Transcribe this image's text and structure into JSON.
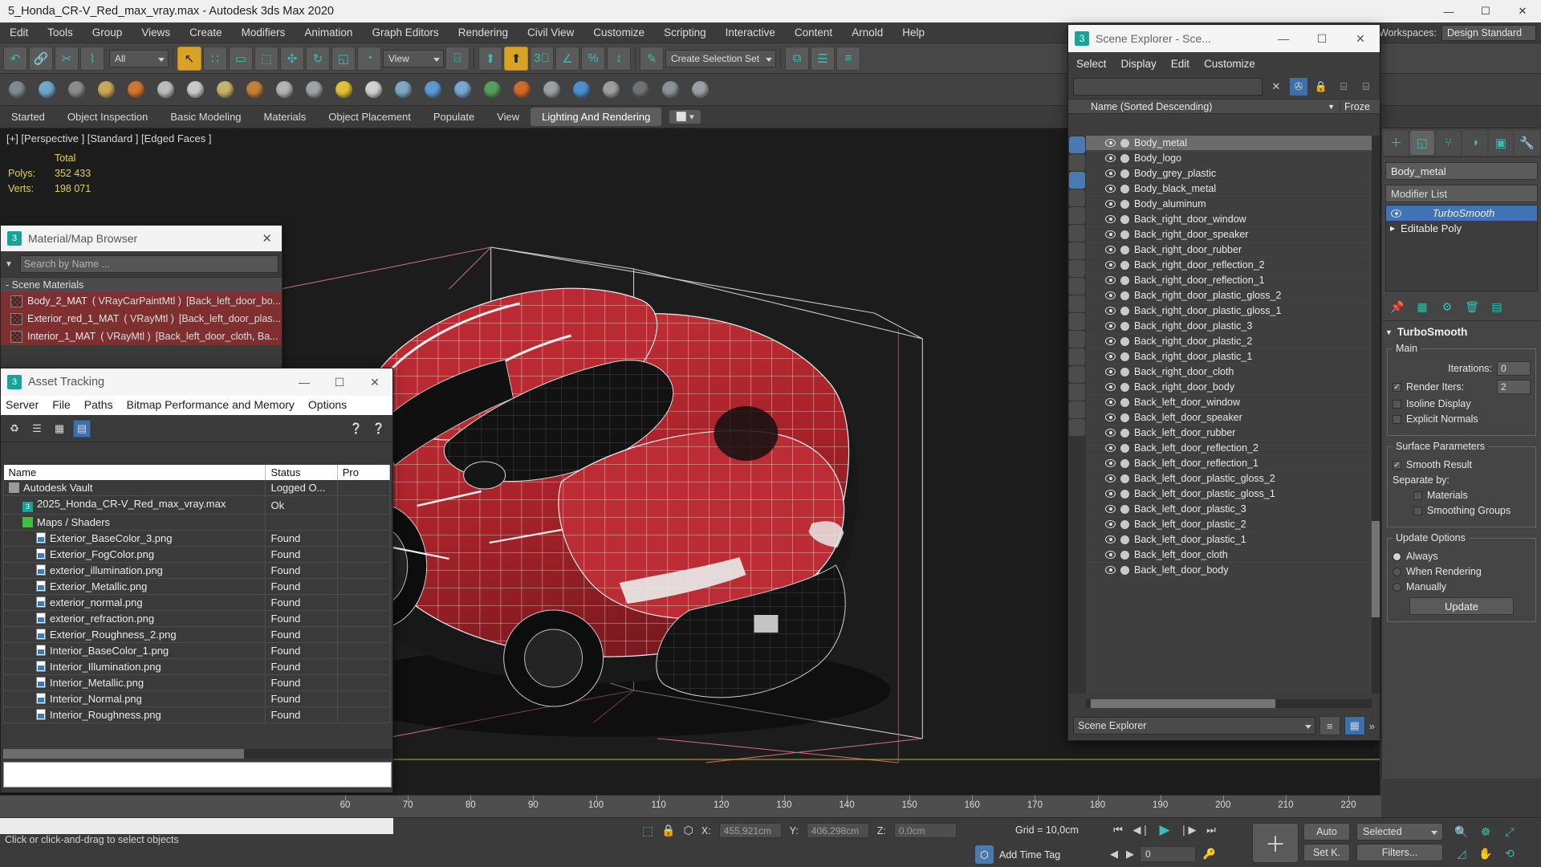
{
  "window": {
    "title": "5_Honda_CR-V_Red_max_vray.max - Autodesk 3ds Max 2020",
    "minimize": "—",
    "maximize": "☐",
    "close": "✕"
  },
  "menubar": {
    "items": [
      "Edit",
      "Tools",
      "Group",
      "Views",
      "Create",
      "Modifiers",
      "Animation",
      "Graph Editors",
      "Rendering",
      "Civil View",
      "Customize",
      "Scripting",
      "Interactive",
      "Content",
      "Arnold",
      "Help"
    ]
  },
  "workspaces": {
    "label": "Workspaces:",
    "value": "Design Standard"
  },
  "maintoolbar": {
    "undo": "↶",
    "redo": "↷",
    "link": "🔗",
    "unlink": "✂",
    "bind": "⌇",
    "selection_filter": "All",
    "select_object": "↖",
    "select_name": "∷",
    "rect_select": "▭",
    "fence": "⬚",
    "move": "✣",
    "rotate": "↻",
    "scale": "◱",
    "placement": "◔",
    "ref_coord": "View",
    "pivot": "⌸",
    "use_center": "⬆",
    "snap3d": "3⃞",
    "angle_snap": "∠",
    "percent_snap": "%",
    "spinner_snap": "↕",
    "named_sets_icon": "✎",
    "named_selection_set": "Create Selection Set",
    "mirror": "⧉",
    "align": "☰",
    "layers": "≡"
  },
  "ribbon_toolbar": {
    "icons": [
      "geosphere-icon",
      "box-icon",
      "array-icon",
      "teapot-icon",
      "bone-icon",
      "sphere-icon",
      "material-editor-icon",
      "render-setup-icon",
      "torus-icon",
      "cone-icon",
      "cylinder-icon",
      "light-icon",
      "sphere2-icon",
      "particles-icon",
      "atom-icon",
      "globe-icon",
      "tree-icon",
      "fire-icon",
      "camera-icon",
      "world-icon",
      "render-frame-icon",
      "render-production-icon",
      "render-iterative-icon",
      "help-icon"
    ]
  },
  "ribbon_tabs": {
    "items": [
      "Started",
      "Object Inspection",
      "Basic Modeling",
      "Materials",
      "Object Placement",
      "Populate",
      "View",
      "Lighting And Rendering"
    ],
    "active": "Lighting And Rendering",
    "extra": "⬜"
  },
  "viewport": {
    "label": "[+] [Perspective ] [Standard ] [Edged Faces ]",
    "stats_title": "Total",
    "polys_label": "Polys:",
    "polys_value": "352 433",
    "verts_label": "Verts:",
    "verts_value": "198 071"
  },
  "material_browser": {
    "title": "Material/Map Browser",
    "close": "✕",
    "search_placeholder": "Search by Name ...",
    "group": "- Scene Materials",
    "items": [
      {
        "name": "Body_2_MAT",
        "type": "( VRayCarPaintMtl )",
        "assign": "[Back_left_door_bo...",
        "selected": true
      },
      {
        "name": "Exterior_red_1_MAT",
        "type": "( VRayMtl )",
        "assign": "[Back_left_door_plas...",
        "selected": true
      },
      {
        "name": "Interior_1_MAT",
        "type": "( VRayMtl )",
        "assign": "[Back_left_door_cloth, Ba...",
        "selected": true
      }
    ]
  },
  "asset_tracking": {
    "title": "Asset Tracking",
    "minimize": "—",
    "maximize": "☐",
    "close": "✕",
    "menu": [
      "Server",
      "File",
      "Paths",
      "Bitmap Performance and Memory",
      "Options"
    ],
    "columns": [
      "Name",
      "Status",
      "Pro"
    ],
    "rows": [
      {
        "indent": 1,
        "icon": "vault-icon",
        "name": "Autodesk Vault",
        "status": "Logged O..."
      },
      {
        "indent": 2,
        "icon": "max-file-icon",
        "name": "2025_Honda_CR-V_Red_max_vray.max",
        "status": "Ok"
      },
      {
        "indent": 2,
        "icon": "maps-icon",
        "name": "Maps / Shaders",
        "status": ""
      },
      {
        "indent": 3,
        "icon": "png-icon",
        "name": "Exterior_BaseColor_3.png",
        "status": "Found"
      },
      {
        "indent": 3,
        "icon": "png-icon",
        "name": "Exterior_FogColor.png",
        "status": "Found"
      },
      {
        "indent": 3,
        "icon": "png-icon",
        "name": "exterior_illumination.png",
        "status": "Found"
      },
      {
        "indent": 3,
        "icon": "png-icon",
        "name": "Exterior_Metallic.png",
        "status": "Found"
      },
      {
        "indent": 3,
        "icon": "png-icon",
        "name": "exterior_normal.png",
        "status": "Found"
      },
      {
        "indent": 3,
        "icon": "png-icon",
        "name": "exterior_refraction.png",
        "status": "Found"
      },
      {
        "indent": 3,
        "icon": "png-icon",
        "name": "Exterior_Roughness_2.png",
        "status": "Found"
      },
      {
        "indent": 3,
        "icon": "png-icon",
        "name": "Interior_BaseColor_1.png",
        "status": "Found"
      },
      {
        "indent": 3,
        "icon": "png-icon",
        "name": "Interior_Illumination.png",
        "status": "Found"
      },
      {
        "indent": 3,
        "icon": "png-icon",
        "name": "Interior_Metallic.png",
        "status": "Found"
      },
      {
        "indent": 3,
        "icon": "png-icon",
        "name": "Interior_Normal.png",
        "status": "Found"
      },
      {
        "indent": 3,
        "icon": "png-icon",
        "name": "Interior_Roughness.png",
        "status": "Found"
      }
    ]
  },
  "scene_explorer": {
    "title": "Scene Explorer - Sce...",
    "app_icon": "3",
    "minimize": "—",
    "maximize": "☐",
    "close": "✕",
    "menu": [
      "Select",
      "Display",
      "Edit",
      "Customize"
    ],
    "filter_value": "",
    "clear_icon": "✕",
    "funnel_icon": "✇",
    "lock_icon": "🔒",
    "expand_icon": "⌸",
    "collapse_icon": "⌸",
    "column_name": "Name (Sorted Descending)",
    "column_sort_arrow": "▼",
    "column_frozen": "Froze",
    "footer_combo": "Scene Explorer",
    "footer_layers_icon": "≡",
    "footer_grid_icon": "▦",
    "footer_more": "»",
    "items": [
      {
        "name": "Body_metal",
        "selected": true
      },
      {
        "name": "Body_logo",
        "selected": false
      },
      {
        "name": "Body_grey_plastic",
        "selected": false
      },
      {
        "name": "Body_black_metal",
        "selected": false
      },
      {
        "name": "Body_aluminum",
        "selected": false
      },
      {
        "name": "Back_right_door_window",
        "selected": false
      },
      {
        "name": "Back_right_door_speaker",
        "selected": false
      },
      {
        "name": "Back_right_door_rubber",
        "selected": false
      },
      {
        "name": "Back_right_door_reflection_2",
        "selected": false
      },
      {
        "name": "Back_right_door_reflection_1",
        "selected": false
      },
      {
        "name": "Back_right_door_plastic_gloss_2",
        "selected": false
      },
      {
        "name": "Back_right_door_plastic_gloss_1",
        "selected": false
      },
      {
        "name": "Back_right_door_plastic_3",
        "selected": false
      },
      {
        "name": "Back_right_door_plastic_2",
        "selected": false
      },
      {
        "name": "Back_right_door_plastic_1",
        "selected": false
      },
      {
        "name": "Back_right_door_cloth",
        "selected": false
      },
      {
        "name": "Back_right_door_body",
        "selected": false
      },
      {
        "name": "Back_left_door_window",
        "selected": false
      },
      {
        "name": "Back_left_door_speaker",
        "selected": false
      },
      {
        "name": "Back_left_door_rubber",
        "selected": false
      },
      {
        "name": "Back_left_door_reflection_2",
        "selected": false
      },
      {
        "name": "Back_left_door_reflection_1",
        "selected": false
      },
      {
        "name": "Back_left_door_plastic_gloss_2",
        "selected": false
      },
      {
        "name": "Back_left_door_plastic_gloss_1",
        "selected": false
      },
      {
        "name": "Back_left_door_plastic_3",
        "selected": false
      },
      {
        "name": "Back_left_door_plastic_2",
        "selected": false
      },
      {
        "name": "Back_left_door_plastic_1",
        "selected": false
      },
      {
        "name": "Back_left_door_cloth",
        "selected": false
      },
      {
        "name": "Back_left_door_body",
        "selected": false
      }
    ]
  },
  "command_panel": {
    "tabs": [
      "create-tab",
      "modify-tab",
      "hierarchy-tab",
      "motion-tab",
      "display-tab",
      "utilities-tab"
    ],
    "tab_glyphs": [
      "＋",
      "◱",
      "⑂",
      "◑",
      "▣",
      "🔧"
    ],
    "active_tab_index": 1,
    "object_name": "Body_metal",
    "modifier_list_label": "Modifier List",
    "stack": [
      {
        "name": "TurboSmooth",
        "active": true
      },
      {
        "name": "Editable Poly",
        "active": false
      }
    ],
    "stack_buttons": [
      "pin-icon",
      "bin-icon",
      "configure-icon",
      "make-unique-icon",
      "delete-icon",
      "show-icon"
    ],
    "rollout": {
      "title": "TurboSmooth",
      "main_label": "Main",
      "iterations_label": "Iterations:",
      "iterations_value": "0",
      "render_iters_label": "Render Iters:",
      "render_iters_value": "2",
      "render_iters_checked": true,
      "isoline_label": "Isoline Display",
      "isoline_checked": false,
      "explicit_label": "Explicit Normals",
      "explicit_checked": false,
      "surface_label": "Surface Parameters",
      "smooth_result_label": "Smooth Result",
      "smooth_result_checked": true,
      "separate_by_label": "Separate by:",
      "materials_label": "Materials",
      "materials_checked": false,
      "smoothing_groups_label": "Smoothing Groups",
      "smoothing_groups_checked": false,
      "update_options_label": "Update Options",
      "always_label": "Always",
      "when_rendering_label": "When Rendering",
      "manually_label": "Manually",
      "update_selected": "Always",
      "update_button": "Update"
    }
  },
  "timeline": {
    "ticks": [
      "60",
      "70",
      "80",
      "90",
      "100",
      "110",
      "120",
      "130",
      "140",
      "150",
      "160",
      "170",
      "180",
      "190",
      "200",
      "210",
      "220"
    ]
  },
  "statusbar": {
    "log_line": "",
    "hint": "Click or click-and-drag to select objects",
    "select_icon": "⬚",
    "lock_icon": "🔒",
    "abs_icon": "⬡",
    "x_label": "X:",
    "x_value": "455,921cm",
    "y_label": "Y:",
    "y_value": "406,298cm",
    "z_label": "Z:",
    "z_value": "0,0cm",
    "grid": "Grid = 10,0cm",
    "add_time_tag": "Add Time Tag",
    "time_tag_icon": "⬡",
    "playback": {
      "first": "⏮",
      "prev": "◀❘",
      "play": "▶",
      "next": "❘▶",
      "last": "⏭"
    },
    "key_mode": {
      "prev": "◀",
      "next": "▶",
      "frame": "0",
      "key_icon": "🔑"
    },
    "set_key_icon": "＋",
    "auto_key": "Auto",
    "set_key": "Set K.",
    "selection_set": "Selected",
    "filters": "Filters...",
    "nav_icons": [
      "zoom-icon",
      "zoom-all-icon",
      "zoom-extents-icon",
      "field-of-view-icon",
      "pan-icon",
      "orbit-icon",
      "maximize-viewport-icon"
    ]
  }
}
